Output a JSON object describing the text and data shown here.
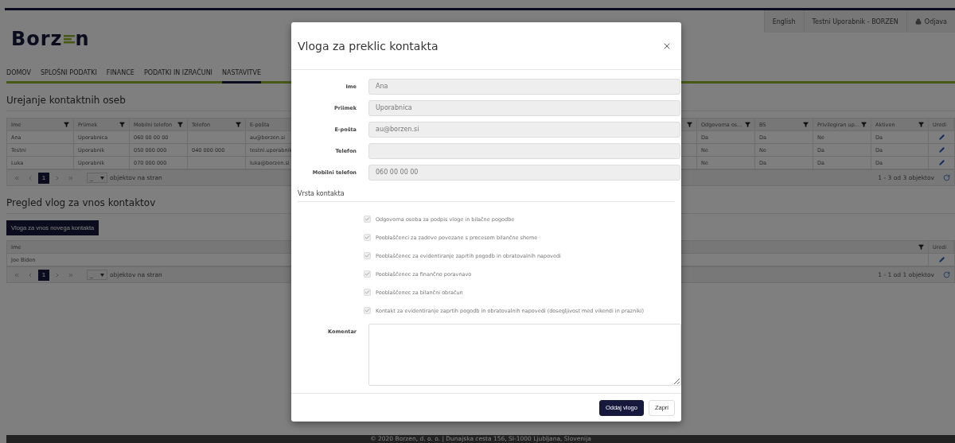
{
  "header": {
    "logo": {
      "before": "Borz",
      "after": "n"
    },
    "top_links": [
      {
        "kind": "plain",
        "label": "English"
      },
      {
        "kind": "plain",
        "label": "Testni Uporabnik - BORZEN"
      },
      {
        "kind": "lock",
        "label": "Odjava"
      }
    ]
  },
  "nav": [
    {
      "label": "DOMOV",
      "selected": false
    },
    {
      "label": "SPLOŠNI PODATKI",
      "selected": false
    },
    {
      "label": "FINANCE",
      "selected": false
    },
    {
      "label": "PODATKI IN IZRAČUNI",
      "selected": false
    },
    {
      "label": "NASTAVITVE",
      "selected": true
    }
  ],
  "contacts": {
    "title": "Urejanje kontaktnih oseb",
    "columns": [
      {
        "label": "Ime",
        "filter": true
      },
      {
        "label": "Priimek",
        "filter": true
      },
      {
        "label": "Mobilni telefon",
        "filter": true
      },
      {
        "label": "Telefon",
        "filter": true
      },
      {
        "label": "E-pošta"
      },
      {
        "filter": true
      },
      {
        "label": "Odgovorna os...",
        "filter": true
      },
      {
        "label": "BS",
        "filter": true
      },
      {
        "label": "Privilegiran up...",
        "filter": true
      },
      {
        "label": "Aktiven",
        "filter": true
      },
      {
        "label": "Uredi"
      }
    ],
    "rows": [
      [
        "Ana",
        "Uporabnica",
        "060 00 00 00",
        "",
        "au@borzen.si",
        "",
        "Da",
        "Da",
        "Ne",
        "Da"
      ],
      [
        "Testni",
        "Uporabnik",
        "050 000 000",
        "040 000 000",
        "testni.uporabnik",
        "",
        "Ne",
        "Ne",
        "Da",
        "Da"
      ],
      [
        "Luka",
        "Uporabnik",
        "070 000 000",
        "",
        "luka@borzen.si",
        "",
        "Ne",
        "Da",
        "Da",
        "Da"
      ]
    ],
    "pager": {
      "page": "1",
      "size": "_",
      "size_label": "objektov na stran",
      "summary": "1 - 3 od 3 objektov"
    }
  },
  "requests": {
    "title": "Pregled vlog za vnos kontaktov",
    "new_button": "Vloga za vnos novega kontakta",
    "columns": [
      {
        "label": "Ime",
        "filter": true
      },
      {
        "label": "Uredi"
      }
    ],
    "rows": [
      [
        "Joe Biden"
      ]
    ],
    "pager": {
      "page": "1",
      "size": "_",
      "size_label": "objektov na stran",
      "summary": "1 - 1 od 1 objektov"
    }
  },
  "footer": "© 2020 Borzen, d. o. o. | Dunajska cesta 156, SI-1000 Ljubljana, Slovenija",
  "dialog": {
    "title": "Vloga za preklic kontakta",
    "fields": [
      {
        "label": "Ime",
        "value": "Ana",
        "disabled": true
      },
      {
        "label": "Priimek",
        "value": "Uporabnica",
        "disabled": true
      },
      {
        "label": "E-pošta",
        "value": "au@borzen.si",
        "disabled": true
      },
      {
        "label": "Telefon",
        "disabled": true
      },
      {
        "label": "Mobilni telefon",
        "value": "060 00 00 00",
        "disabled": true
      }
    ],
    "section": "Vrsta kontakta",
    "options": [
      {
        "label": "Odgovorna oseba za podpis vloge in bilačne pogodbe",
        "checked": true,
        "disabled": true
      },
      {
        "label": "Pooblaščenci za zadeve povezane s procesom bilančne sheme",
        "checked": true,
        "disabled": true
      },
      {
        "label": "Pooblaščenec za evidentiranje zaprtih pogodb in obratovalnih napovedi",
        "checked": true,
        "disabled": true
      },
      {
        "label": "Pooblaščenec za finančno poravnavo",
        "checked": true,
        "disabled": true
      },
      {
        "label": "Pooblaščenec za bilančni obračun",
        "checked": true,
        "disabled": true
      },
      {
        "label": "Kontakt za evidentiranje zaprtih pogodb in obratovalnih napovedi (dosegljivost med vikendi in prazniki)",
        "checked": true,
        "disabled": true
      }
    ],
    "comment": {
      "label": "Komentar"
    },
    "buttons": [
      {
        "kind": "primary",
        "label": "Oddaj vlogo"
      },
      {
        "kind": "secondary",
        "label": "Zapri"
      }
    ]
  }
}
